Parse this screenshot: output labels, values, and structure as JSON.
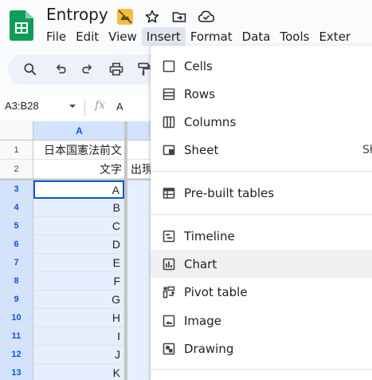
{
  "app": {
    "doc_title": "Entropy",
    "colors": {
      "sheets_green": "#0f9d58",
      "selection_blue": "#0b57d0",
      "accent_badge": "#f3bd42"
    }
  },
  "title_icons": [
    "sheet-badge-icon",
    "star-icon",
    "move-to-folder-icon",
    "cloud-status-icon"
  ],
  "menubar": [
    "File",
    "Edit",
    "View",
    "Insert",
    "Format",
    "Data",
    "Tools",
    "Exter"
  ],
  "toolbar_icons": [
    "search-icon",
    "undo-icon",
    "redo-icon",
    "print-icon",
    "paint-format-icon"
  ],
  "formula_bar": {
    "namebox": "A3:B28",
    "fx": "fx",
    "value": "A"
  },
  "grid": {
    "columns": [
      "A"
    ],
    "row_numbers": [
      "1",
      "2",
      "3",
      "4",
      "5",
      "6",
      "7",
      "8",
      "9",
      "10",
      "11",
      "12",
      "13"
    ],
    "col_a": [
      "日本国憲法前文",
      "文字",
      "A",
      "B",
      "C",
      "D",
      "E",
      "F",
      "G",
      "H",
      "I",
      "J",
      "K"
    ],
    "col_b_row2": "出現"
  },
  "insert_menu": {
    "items": [
      {
        "label": "Cells",
        "icon": "cells-icon"
      },
      {
        "label": "Rows",
        "icon": "rows-icon"
      },
      {
        "label": "Columns",
        "icon": "columns-icon"
      },
      {
        "label": "Sheet",
        "icon": "sheet-icon",
        "shortcut": "Sł"
      },
      {
        "label": "Pre-built tables",
        "icon": "prebuilt-tables-icon"
      },
      {
        "label": "Timeline",
        "icon": "timeline-icon"
      },
      {
        "label": "Chart",
        "icon": "chart-icon"
      },
      {
        "label": "Pivot table",
        "icon": "pivot-table-icon"
      },
      {
        "label": "Image",
        "icon": "image-icon"
      },
      {
        "label": "Drawing",
        "icon": "drawing-icon"
      }
    ]
  }
}
